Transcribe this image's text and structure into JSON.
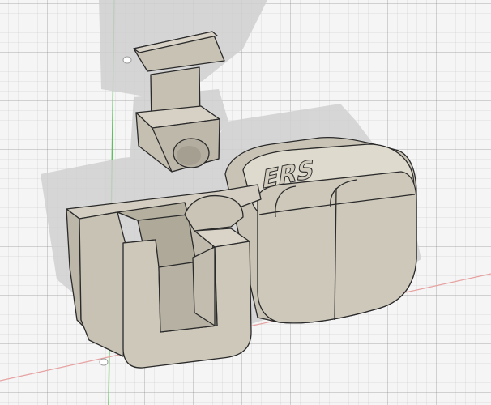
{
  "viewport": {
    "background_color": "#f5f5f5",
    "grid_color": "#c8c8c8",
    "y_axis_color": "#5fbf5f",
    "x_axis_color": "#e07a7a"
  },
  "model": {
    "body_color": "#c9c4b6",
    "body_light": "#dcd8cc",
    "body_dark": "#a8a294",
    "edge_color": "#2a2a2a",
    "shadow_color": "#cfcfcf",
    "embossed_text": "ERS"
  }
}
